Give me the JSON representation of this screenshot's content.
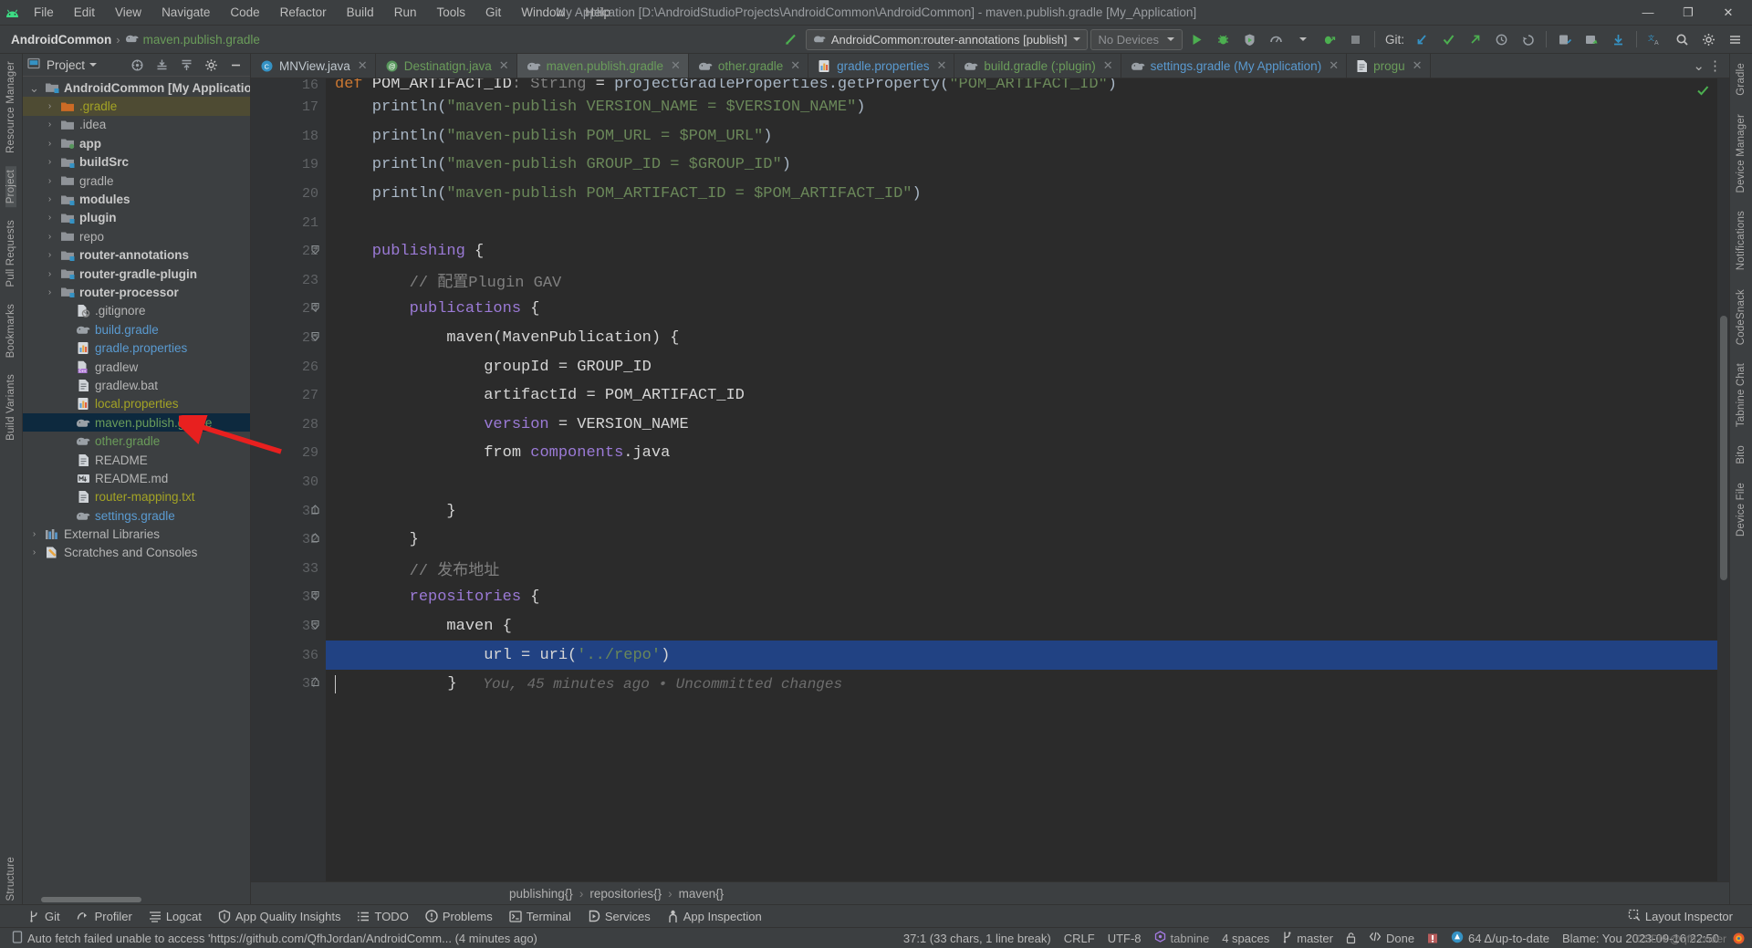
{
  "titlebar": {
    "menu": [
      "File",
      "Edit",
      "View",
      "Navigate",
      "Code",
      "Refactor",
      "Build",
      "Run",
      "Tools",
      "Git",
      "Window",
      "Help"
    ],
    "window_title": "My Application [D:\\AndroidStudioProjects\\AndroidCommon\\AndroidCommon] - maven.publish.gradle [My_Application]",
    "minimize": "—",
    "maximize": "❐",
    "close": "✕"
  },
  "navbar": {
    "breadcrumb_project": "AndroidCommon",
    "breadcrumb_sep": "›",
    "breadcrumb_file": "maven.publish.gradle",
    "run_config": "AndroidCommon:router-annotations [publish]",
    "device": "No Devices",
    "git_label": "Git:"
  },
  "project_panel": {
    "title": "Project",
    "tree": [
      {
        "label": "AndroidCommon [My Application]",
        "indent": 0,
        "twisty": "˅",
        "icon": "folder-module",
        "color": "c-white",
        "bold": true,
        "state": "none"
      },
      {
        "label": ".gradle",
        "indent": 1,
        "twisty": "›",
        "icon": "folder-orange",
        "color": "c-olive",
        "bold": false,
        "state": "selected-gray"
      },
      {
        "label": ".idea",
        "indent": 1,
        "twisty": "›",
        "icon": "folder-plain",
        "color": "c-gray",
        "bold": false,
        "state": "none"
      },
      {
        "label": "app",
        "indent": 1,
        "twisty": "›",
        "icon": "folder-green",
        "color": "c-white",
        "bold": true,
        "state": "none"
      },
      {
        "label": "buildSrc",
        "indent": 1,
        "twisty": "›",
        "icon": "folder-module",
        "color": "c-white",
        "bold": true,
        "state": "none"
      },
      {
        "label": "gradle",
        "indent": 1,
        "twisty": "›",
        "icon": "folder-plain",
        "color": "c-gray",
        "bold": false,
        "state": "none"
      },
      {
        "label": "modules",
        "indent": 1,
        "twisty": "›",
        "icon": "folder-module",
        "color": "c-white",
        "bold": true,
        "state": "none"
      },
      {
        "label": "plugin",
        "indent": 1,
        "twisty": "›",
        "icon": "folder-module",
        "color": "c-white",
        "bold": true,
        "state": "none"
      },
      {
        "label": "repo",
        "indent": 1,
        "twisty": "›",
        "icon": "folder-plain",
        "color": "c-gray",
        "bold": false,
        "state": "none"
      },
      {
        "label": "router-annotations",
        "indent": 1,
        "twisty": "›",
        "icon": "folder-module",
        "color": "c-white",
        "bold": true,
        "state": "none"
      },
      {
        "label": "router-gradle-plugin",
        "indent": 1,
        "twisty": "›",
        "icon": "folder-module",
        "color": "c-white",
        "bold": true,
        "state": "none"
      },
      {
        "label": "router-processor",
        "indent": 1,
        "twisty": "›",
        "icon": "folder-module",
        "color": "c-white",
        "bold": true,
        "state": "none"
      },
      {
        "label": ".gitignore",
        "indent": 2,
        "twisty": "",
        "icon": "gitignore",
        "color": "c-gray",
        "bold": false,
        "state": "none"
      },
      {
        "label": "build.gradle",
        "indent": 2,
        "twisty": "",
        "icon": "gradle",
        "color": "c-blue",
        "bold": false,
        "state": "none"
      },
      {
        "label": "gradle.properties",
        "indent": 2,
        "twisty": "",
        "icon": "properties",
        "color": "c-blue",
        "bold": false,
        "state": "none"
      },
      {
        "label": "gradlew",
        "indent": 2,
        "twisty": "",
        "icon": "cpp-file",
        "color": "c-gray",
        "bold": false,
        "state": "none"
      },
      {
        "label": "gradlew.bat",
        "indent": 2,
        "twisty": "",
        "icon": "doc",
        "color": "c-gray",
        "bold": false,
        "state": "none"
      },
      {
        "label": "local.properties",
        "indent": 2,
        "twisty": "",
        "icon": "properties",
        "color": "c-olive",
        "bold": false,
        "state": "none"
      },
      {
        "label": "maven.publish.gradle",
        "indent": 2,
        "twisty": "",
        "icon": "gradle",
        "color": "c-green",
        "bold": false,
        "state": "selected-blue"
      },
      {
        "label": "other.gradle",
        "indent": 2,
        "twisty": "",
        "icon": "gradle",
        "color": "c-green",
        "bold": false,
        "state": "none"
      },
      {
        "label": "README",
        "indent": 2,
        "twisty": "",
        "icon": "doc",
        "color": "c-gray",
        "bold": false,
        "state": "none"
      },
      {
        "label": "README.md",
        "indent": 2,
        "twisty": "",
        "icon": "markdown",
        "color": "c-gray",
        "bold": false,
        "state": "none"
      },
      {
        "label": "router-mapping.txt",
        "indent": 2,
        "twisty": "",
        "icon": "doc",
        "color": "c-olive",
        "bold": false,
        "state": "none"
      },
      {
        "label": "settings.gradle",
        "indent": 2,
        "twisty": "",
        "icon": "gradle",
        "color": "c-blue",
        "bold": false,
        "state": "none"
      },
      {
        "label": "External Libraries",
        "indent": 0,
        "twisty": "›",
        "icon": "libraries",
        "color": "c-gray",
        "bold": false,
        "state": "none"
      },
      {
        "label": "Scratches and Consoles",
        "indent": 0,
        "twisty": "›",
        "icon": "scratches",
        "color": "c-gray",
        "bold": false,
        "state": "none"
      }
    ]
  },
  "left_rail": [
    "Resource Manager",
    "Project",
    "Pull Requests",
    "Bookmarks",
    "Build Variants",
    "Structure"
  ],
  "right_rail": [
    "Gradle",
    "Device Manager",
    "Notifications",
    "CodeSnack",
    "Tabnine Chat",
    "Bito",
    "Device File"
  ],
  "tabs": [
    {
      "label": "MNView.java",
      "icon": "class-java",
      "active": false,
      "color": "#bfc7cd"
    },
    {
      "label": "Destinatign.java",
      "icon": "annotation-java",
      "active": false,
      "color": "#6a9c5a"
    },
    {
      "label": "maven.publish.gradle",
      "icon": "gradle",
      "active": true,
      "color": "#6a9c5a"
    },
    {
      "label": "other.gradle",
      "icon": "gradle",
      "active": false,
      "color": "#6a9c5a"
    },
    {
      "label": "gradle.properties",
      "icon": "properties",
      "active": false,
      "color": "#5a9ad0"
    },
    {
      "label": "build.gradle (:plugin)",
      "icon": "gradle",
      "active": false,
      "color": "#6a9c5a"
    },
    {
      "label": "settings.gradle (My Application)",
      "icon": "gradle",
      "active": false,
      "color": "#5a9ad0"
    },
    {
      "label": "progu",
      "icon": "doc",
      "active": false,
      "color": "#6a9c5a"
    }
  ],
  "editor": {
    "first_partial_line": {
      "number": "16",
      "segments": [
        {
          "t": "def ",
          "c": "k-key"
        },
        {
          "t": "POM_ARTIFACT_ID",
          "c": "k-white"
        },
        {
          "t": ": String",
          "c": "k-cmt"
        },
        {
          "t": " = ",
          "c": "k-white"
        },
        {
          "t": "projectGradleProperties.getProperty(",
          "c": "k-fn"
        },
        {
          "t": "\"POM_ARTIFACT_ID\"",
          "c": "k-str"
        },
        {
          "t": ")",
          "c": "k-fn"
        }
      ]
    },
    "lines": [
      {
        "number": "17",
        "fold": "",
        "highlight": false,
        "segments": [
          {
            "t": "    println(",
            "c": "k-fn"
          },
          {
            "t": "\"maven-publish VERSION_NAME = $VERSION_NAME\"",
            "c": "k-str"
          },
          {
            "t": ")",
            "c": "k-fn"
          }
        ]
      },
      {
        "number": "18",
        "fold": "",
        "highlight": false,
        "segments": [
          {
            "t": "    println(",
            "c": "k-fn"
          },
          {
            "t": "\"maven-publish POM_URL = $POM_URL\"",
            "c": "k-str"
          },
          {
            "t": ")",
            "c": "k-fn"
          }
        ]
      },
      {
        "number": "19",
        "fold": "",
        "highlight": false,
        "segments": [
          {
            "t": "    println(",
            "c": "k-fn"
          },
          {
            "t": "\"maven-publish GROUP_ID = $GROUP_ID\"",
            "c": "k-str"
          },
          {
            "t": ")",
            "c": "k-fn"
          }
        ]
      },
      {
        "number": "20",
        "fold": "",
        "highlight": false,
        "segments": [
          {
            "t": "    println(",
            "c": "k-fn"
          },
          {
            "t": "\"maven-publish POM_ARTIFACT_ID = $POM_ARTIFACT_ID\"",
            "c": "k-str"
          },
          {
            "t": ")",
            "c": "k-fn"
          }
        ]
      },
      {
        "number": "21",
        "fold": "",
        "highlight": false,
        "segments": []
      },
      {
        "number": "22",
        "fold": "minus",
        "highlight": false,
        "segments": [
          {
            "t": "    publishing ",
            "c": "k-purple"
          },
          {
            "t": "{",
            "c": "k-white"
          }
        ]
      },
      {
        "number": "23",
        "fold": "",
        "highlight": false,
        "segments": [
          {
            "t": "        // 配置Plugin GAV",
            "c": "k-cmt"
          }
        ]
      },
      {
        "number": "24",
        "fold": "minus",
        "highlight": false,
        "segments": [
          {
            "t": "        publications ",
            "c": "k-purple"
          },
          {
            "t": "{",
            "c": "k-white"
          }
        ]
      },
      {
        "number": "25",
        "fold": "minus",
        "highlight": false,
        "segments": [
          {
            "t": "            maven(",
            "c": "k-white"
          },
          {
            "t": "MavenPublication",
            "c": "k-white"
          },
          {
            "t": ") {",
            "c": "k-white"
          }
        ]
      },
      {
        "number": "26",
        "fold": "",
        "highlight": false,
        "segments": [
          {
            "t": "                groupId = ",
            "c": "k-white"
          },
          {
            "t": "GROUP_ID",
            "c": "k-white"
          }
        ]
      },
      {
        "number": "27",
        "fold": "",
        "highlight": false,
        "segments": [
          {
            "t": "                artifactId = ",
            "c": "k-white"
          },
          {
            "t": "POM_ARTIFACT_ID",
            "c": "k-white"
          }
        ]
      },
      {
        "number": "28",
        "fold": "",
        "highlight": false,
        "segments": [
          {
            "t": "                version",
            "c": "k-purple"
          },
          {
            "t": " = VERSION_NAME",
            "c": "k-white"
          }
        ]
      },
      {
        "number": "29",
        "fold": "",
        "highlight": false,
        "segments": [
          {
            "t": "                from ",
            "c": "k-white"
          },
          {
            "t": "components",
            "c": "k-purple"
          },
          {
            "t": ".java",
            "c": "k-white"
          }
        ]
      },
      {
        "number": "30",
        "fold": "",
        "highlight": false,
        "segments": []
      },
      {
        "number": "31",
        "fold": "end",
        "highlight": false,
        "segments": [
          {
            "t": "            }",
            "c": "k-white"
          }
        ]
      },
      {
        "number": "32",
        "fold": "end",
        "highlight": false,
        "segments": [
          {
            "t": "        }",
            "c": "k-white"
          }
        ]
      },
      {
        "number": "33",
        "fold": "",
        "highlight": false,
        "segments": [
          {
            "t": "        // 发布地址",
            "c": "k-cmt"
          }
        ]
      },
      {
        "number": "34",
        "fold": "minus",
        "highlight": false,
        "segments": [
          {
            "t": "        repositories ",
            "c": "k-purple"
          },
          {
            "t": "{",
            "c": "k-white"
          }
        ]
      },
      {
        "number": "35",
        "fold": "minus",
        "highlight": false,
        "segments": [
          {
            "t": "            maven ",
            "c": "k-white"
          },
          {
            "t": "{",
            "c": "k-white"
          }
        ]
      },
      {
        "number": "36",
        "fold": "",
        "highlight": true,
        "segments": [
          {
            "t": "                url = ",
            "c": "k-white"
          },
          {
            "t": "uri(",
            "c": "k-white"
          },
          {
            "t": "'../repo'",
            "c": "k-str"
          },
          {
            "t": ")",
            "c": "k-white"
          }
        ]
      },
      {
        "number": "37",
        "fold": "end",
        "highlight": false,
        "segments": [
          {
            "t": "            }",
            "c": "k-white"
          },
          {
            "t": "   You, 45 minutes ago • Uncommitted changes",
            "c": "k-blame"
          }
        ]
      }
    ],
    "breadcrumbs": [
      "publishing{}",
      "repositories{}",
      "maven{}"
    ]
  },
  "bottom_tools": [
    {
      "label": "Git",
      "icon": "git-branch-icon"
    },
    {
      "label": "Profiler",
      "icon": "profiler-icon"
    },
    {
      "label": "Logcat",
      "icon": "logcat-icon"
    },
    {
      "label": "App Quality Insights",
      "icon": "quality-icon"
    },
    {
      "label": "TODO",
      "icon": "todo-icon"
    },
    {
      "label": "Problems",
      "icon": "problems-icon"
    },
    {
      "label": "Terminal",
      "icon": "terminal-icon"
    },
    {
      "label": "Services",
      "icon": "services-icon"
    },
    {
      "label": "App Inspection",
      "icon": "inspection-icon"
    }
  ],
  "layout_inspector": "Layout Inspector",
  "statusbar": {
    "message": "Auto fetch failed unable to access 'https://github.com/QfhJordan/AndroidComm... (4 minutes ago)",
    "caret": "37:1 (33 chars, 1 line break)",
    "line_sep": "CRLF",
    "encoding": "UTF-8",
    "plugin": "tabnine",
    "indent": "4 spaces",
    "branch": "master",
    "lock": "🔓",
    "done": "Done",
    "updates": "64 Δ/up-to-date",
    "blame": "Blame: You 2023-09-16 22:50",
    "watermark": "CSDN @qfh coder"
  },
  "colors": {
    "accent_green": "#6a9c5a",
    "selection_blue": "#214283",
    "tree_selection": "#0d293e",
    "arrow_red": "#e8201f",
    "editor_bg": "#2b2b2b",
    "panel_bg": "#3c3f41"
  }
}
